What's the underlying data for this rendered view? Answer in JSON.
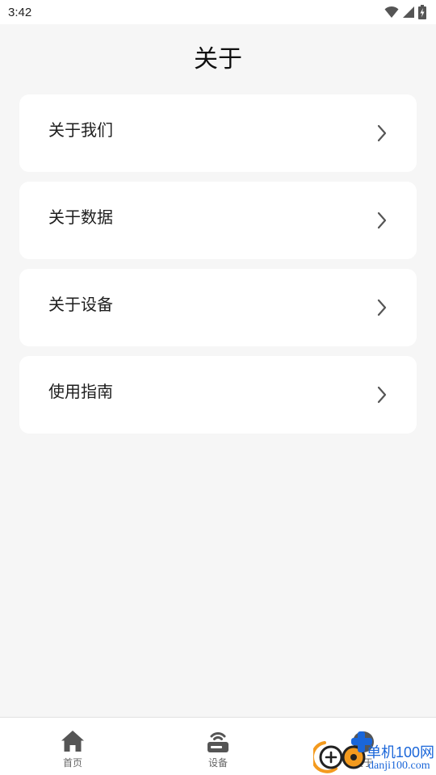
{
  "status_bar": {
    "time": "3:42",
    "icons": [
      "wifi-icon",
      "cellular-signal-icon",
      "battery-charging-icon"
    ]
  },
  "page": {
    "title": "关于"
  },
  "menu": {
    "items": [
      {
        "label": "关于我们",
        "icon": "chevron-right-icon"
      },
      {
        "label": "关于数据",
        "icon": "chevron-right-icon"
      },
      {
        "label": "关于设备",
        "icon": "chevron-right-icon"
      },
      {
        "label": "使用指南",
        "icon": "chevron-right-icon"
      }
    ]
  },
  "bottom_nav": {
    "items": [
      {
        "label": "首页",
        "icon": "home-icon"
      },
      {
        "label": "设备",
        "icon": "router-icon"
      },
      {
        "label": "关于",
        "icon": "info-icon"
      }
    ]
  },
  "watermark": {
    "name_cn": "单机100网",
    "domain": "danji100.com",
    "accent_blue": "#1a66d9",
    "accent_orange": "#f39a1e"
  },
  "colors": {
    "background": "#f6f6f6",
    "card": "#ffffff",
    "text": "#1e1e1e",
    "chevron": "#555555",
    "nav_icon": "#555555"
  }
}
